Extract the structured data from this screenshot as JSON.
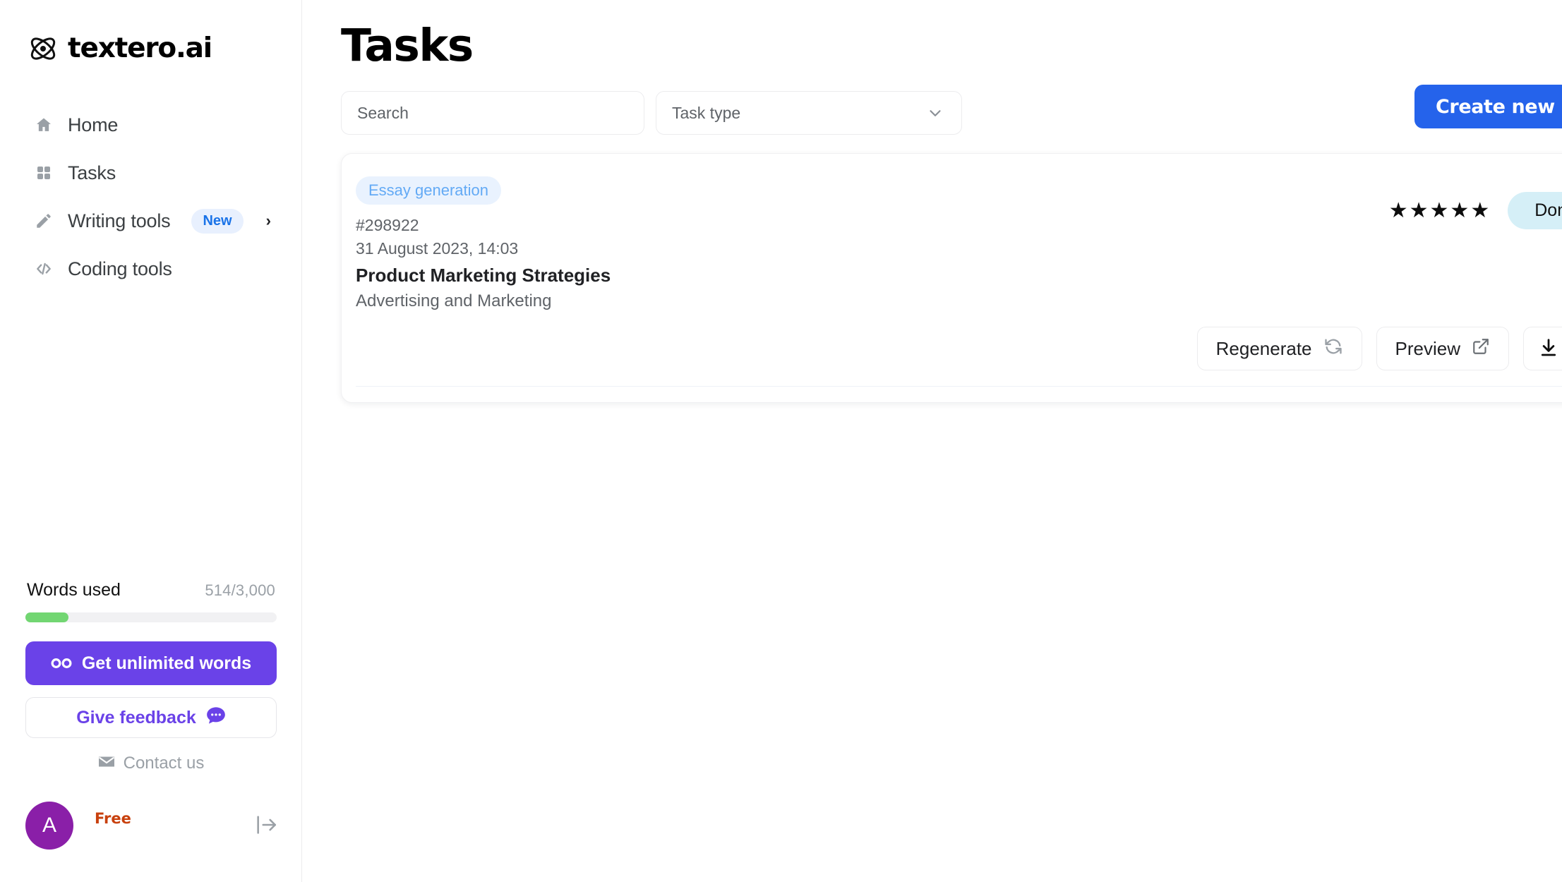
{
  "sidebar": {
    "logo": {
      "text": "textero.ai",
      "icon": "atom-icon"
    },
    "items": [
      {
        "label": "Home",
        "icon": "home-icon"
      },
      {
        "label": "Tasks",
        "icon": "grid-icon"
      },
      {
        "label": "Writing tools",
        "icon": "pencil-icon",
        "badge": "New",
        "chevron": "›"
      },
      {
        "label": "Coding tools",
        "icon": "code-icon"
      }
    ],
    "usage": {
      "label": "Words used",
      "count": "514/3,000",
      "used": 514,
      "limit": 3000,
      "percent": 17
    },
    "unlimited_button": {
      "label": "Get unlimited words",
      "icon": "infinity-icon"
    },
    "feedback_button": {
      "label": "Give feedback",
      "icon": "chat-bubble-icon"
    },
    "contact": {
      "label": "Contact us",
      "icon": "mail-icon"
    },
    "user": {
      "initial": "A",
      "plan": "Free"
    },
    "collapse": {
      "icon": "expand-sidebar-icon"
    }
  },
  "main": {
    "title": "Tasks",
    "search": {
      "placeholder": "Search",
      "value": ""
    },
    "task_type_select": {
      "value": "Task type",
      "chevron": "chevron-down-icon"
    },
    "create_button": {
      "label": "Create new",
      "plus": "+"
    },
    "tasks": [
      {
        "tag": "Essay generation",
        "id": "#298922",
        "date": "31 August 2023, 14:03",
        "title": "Product Marketing Strategies",
        "subtitle": "Advertising and Marketing",
        "rating": "★★★★★",
        "rating_value": 5,
        "status": "Done",
        "actions": {
          "regenerate": "Regenerate",
          "preview": "Preview",
          "download": "download-icon"
        }
      }
    ]
  },
  "colors": {
    "accent_blue": "#2563eb",
    "tag_blue": "#63aaf5",
    "purple": "#6a42e8",
    "green": "#72d672",
    "status_bg": "#d5eff7",
    "plan_orange": "#c8400d",
    "avatar_purple": "#8a1fa8"
  }
}
